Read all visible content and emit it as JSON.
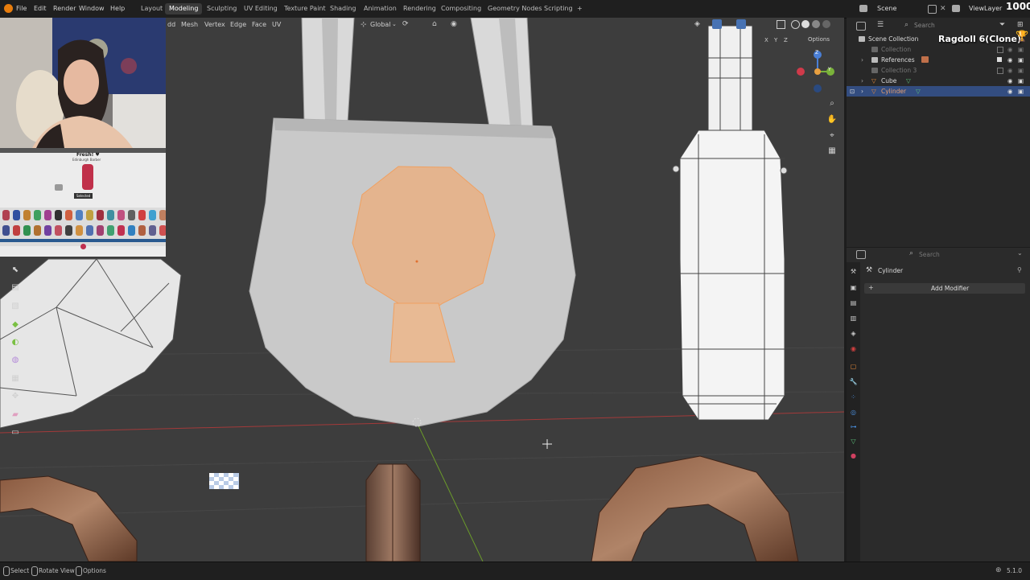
{
  "app": {
    "menu": [
      "File",
      "Edit",
      "Render",
      "Window",
      "Help"
    ],
    "workspaces": [
      "Layout",
      "Modeling",
      "Sculpting",
      "UV Editing",
      "Texture Paint",
      "Shading",
      "Animation",
      "Rendering",
      "Compositing",
      "Geometry Nodes",
      "Scripting"
    ],
    "active_workspace": "Modeling",
    "add_workspace": "+",
    "scene_label": "Scene",
    "viewlayer_label": "ViewLayer",
    "corner_number": "1000"
  },
  "viewport": {
    "menu_fragment": "dd",
    "menus": [
      "Mesh",
      "Vertex",
      "Edge",
      "Face",
      "UV"
    ],
    "transform_orientation": "Global",
    "axes": [
      "X",
      "Y",
      "Z"
    ],
    "options_label": "Options",
    "gizmo_axes": [
      "Z",
      "Y",
      "X"
    ]
  },
  "overlay": {
    "stream_title": "Ragdoll 6(Clone)",
    "game_char_name": "Fresh! ♥",
    "game_char_sub": "Edinburgh Barber",
    "game_selected": "Selected"
  },
  "outliner": {
    "search_placeholder": "Search",
    "root": "Scene Collection",
    "items": [
      {
        "label": "Collection",
        "dim": true
      },
      {
        "label": "References",
        "dim": false
      },
      {
        "label": "Collection 3",
        "dim": true
      },
      {
        "label": "Cube",
        "dim": false
      },
      {
        "label": "Cylinder",
        "dim": false,
        "selected": true
      }
    ]
  },
  "properties": {
    "search_placeholder": "Search",
    "object_name": "Cylinder",
    "add_modifier": "Add Modifier"
  },
  "statusbar": {
    "select": "Select",
    "rotate": "Rotate View",
    "options": "Options",
    "version": "5.1.0"
  },
  "colors": {
    "viewport_bg": "#3d3d3d",
    "selected_face": "#e4b48e",
    "selection_blue": "#334d80",
    "active_workspace": "#3a3a3a"
  }
}
